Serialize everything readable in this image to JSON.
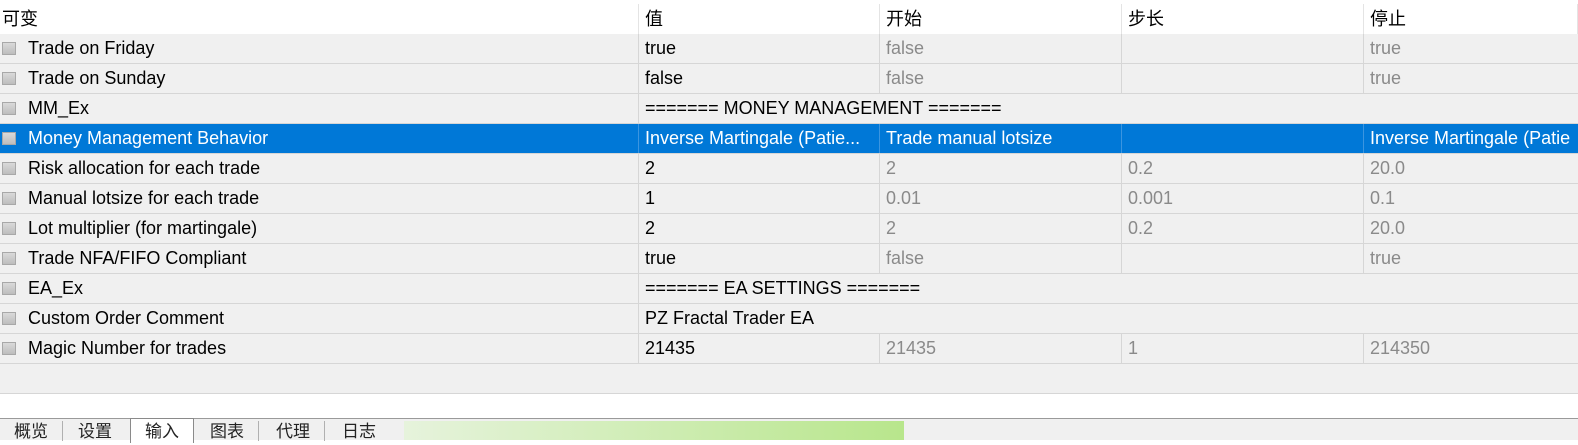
{
  "columns": [
    "可变",
    "值",
    "开始",
    "步长",
    "停止"
  ],
  "rows": [
    {
      "name": "Trade on Friday",
      "value": "true",
      "start": "false",
      "step": "",
      "stop": "true"
    },
    {
      "name": "Trade on Sunday",
      "value": "false",
      "start": "false",
      "step": "",
      "stop": "true"
    },
    {
      "name": "MM_Ex",
      "value": "======= MONEY MANAGEMENT =======",
      "section": true
    },
    {
      "name": "Money Management Behavior",
      "value": "Inverse Martingale (Patie...",
      "start": "Trade manual lotsize",
      "step": "",
      "stop": "Inverse Martingale (Patie",
      "selected": true
    },
    {
      "name": "Risk allocation for each trade",
      "value": "2",
      "start": "2",
      "step": "0.2",
      "stop": "20.0"
    },
    {
      "name": "Manual lotsize for each trade",
      "value": "1",
      "start": "0.01",
      "step": "0.001",
      "stop": "0.1"
    },
    {
      "name": "Lot multiplier (for martingale)",
      "value": "2",
      "start": "2",
      "step": "0.2",
      "stop": "20.0"
    },
    {
      "name": "Trade NFA/FIFO Compliant",
      "value": "true",
      "start": "false",
      "step": "",
      "stop": "true"
    },
    {
      "name": "EA_Ex",
      "value": "======= EA SETTINGS =======",
      "section": true
    },
    {
      "name": "Custom Order Comment",
      "value": "PZ Fractal Trader EA",
      "section": true
    },
    {
      "name": "Magic Number for trades",
      "value": "21435",
      "start": "21435",
      "step": "1",
      "stop": "214350"
    }
  ],
  "tabs": [
    {
      "label": "概览",
      "active": false
    },
    {
      "label": "设置",
      "active": false
    },
    {
      "label": "输入",
      "active": true
    },
    {
      "label": "图表",
      "active": false
    },
    {
      "label": "代理",
      "active": false
    },
    {
      "label": "日志",
      "active": false
    }
  ],
  "progress_color": "#b8e68c",
  "selection_color": "#0078d7"
}
